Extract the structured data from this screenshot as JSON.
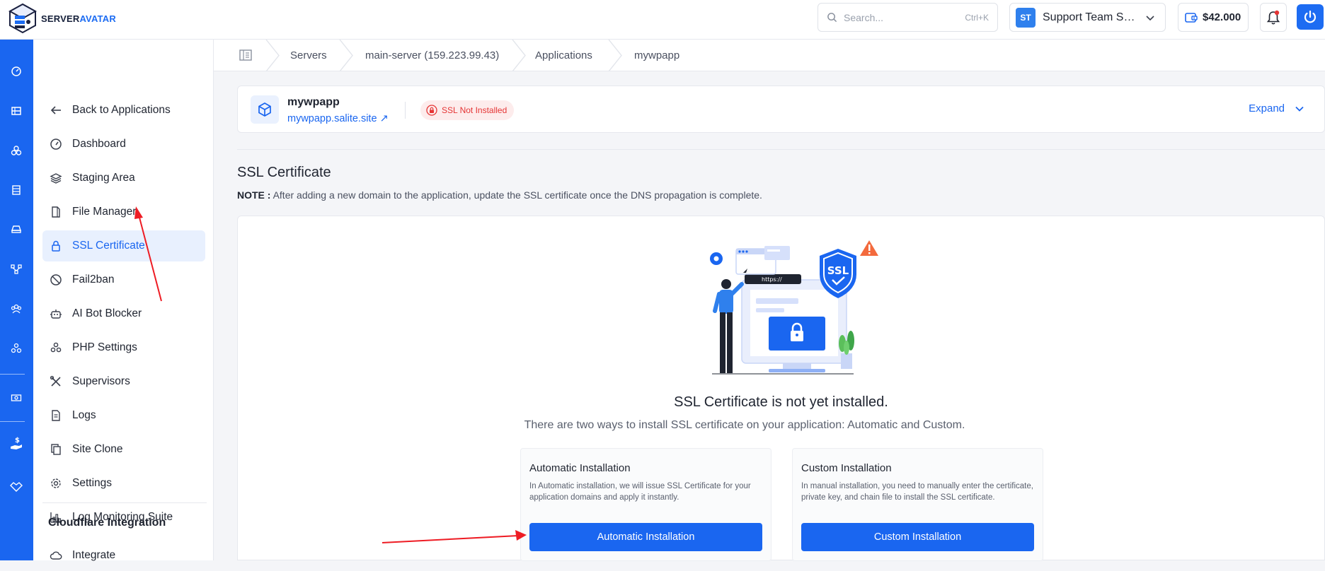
{
  "brand": {
    "name_a": "SERVER",
    "name_b": "AVATAR"
  },
  "header": {
    "search_placeholder": "Search...",
    "search_shortcut": "Ctrl+K",
    "team_initials": "ST",
    "team_name": "Support Team Se...",
    "balance": "$42.000",
    "colors": {
      "accent": "#1a66f0",
      "danger": "#e53535"
    }
  },
  "sidebar": {
    "items": [
      {
        "label": "Back to Applications",
        "icon": "arrow-left-icon"
      },
      {
        "label": "Dashboard",
        "icon": "gauge-icon"
      },
      {
        "label": "Staging Area",
        "icon": "layers-icon"
      },
      {
        "label": "File Manager",
        "icon": "file-icon"
      },
      {
        "label": "SSL Certificate",
        "icon": "lock-icon",
        "active": true
      },
      {
        "label": "Fail2ban",
        "icon": "ban-icon"
      },
      {
        "label": "AI Bot Blocker",
        "icon": "robot-icon"
      },
      {
        "label": "PHP Settings",
        "icon": "cluster-icon"
      },
      {
        "label": "Supervisors",
        "icon": "tools-icon"
      },
      {
        "label": "Logs",
        "icon": "document-icon"
      },
      {
        "label": "Site Clone",
        "icon": "copy-icon"
      },
      {
        "label": "Settings",
        "icon": "gear-icon"
      },
      {
        "label": "Log Monitoring Suite",
        "icon": "bar-chart-icon"
      }
    ],
    "section_heading": "Cloudflare Integration",
    "section_items": [
      {
        "label": "Integrate",
        "icon": "cloud-icon"
      }
    ]
  },
  "breadcrumb": [
    "Servers",
    "main-server (159.223.99.43)",
    "Applications",
    "mywpapp"
  ],
  "app": {
    "name": "mywpapp",
    "domain": "mywpapp.salite.site",
    "ssl_status": "SSL Not Installed",
    "expand_label": "Expand"
  },
  "ssl": {
    "title": "SSL Certificate",
    "note_label": "NOTE :",
    "note_text": "After adding a new domain to the application, update the SSL certificate once the DNS propagation is complete.",
    "headline": "SSL Certificate is not yet installed.",
    "subline": "There are two ways to install SSL certificate on your application: Automatic and Custom.",
    "illustration": {
      "badge": "SSL",
      "url": "https://"
    },
    "options": [
      {
        "title": "Automatic Installation",
        "desc": "In Automatic installation, we will issue SSL Certificate for your application domains and apply it instantly.",
        "button": "Automatic Installation"
      },
      {
        "title": "Custom Installation",
        "desc": "In manual installation, you need to manually enter the certificate, private key, and chain file to install the SSL certificate.",
        "button": "Custom Installation"
      }
    ]
  }
}
